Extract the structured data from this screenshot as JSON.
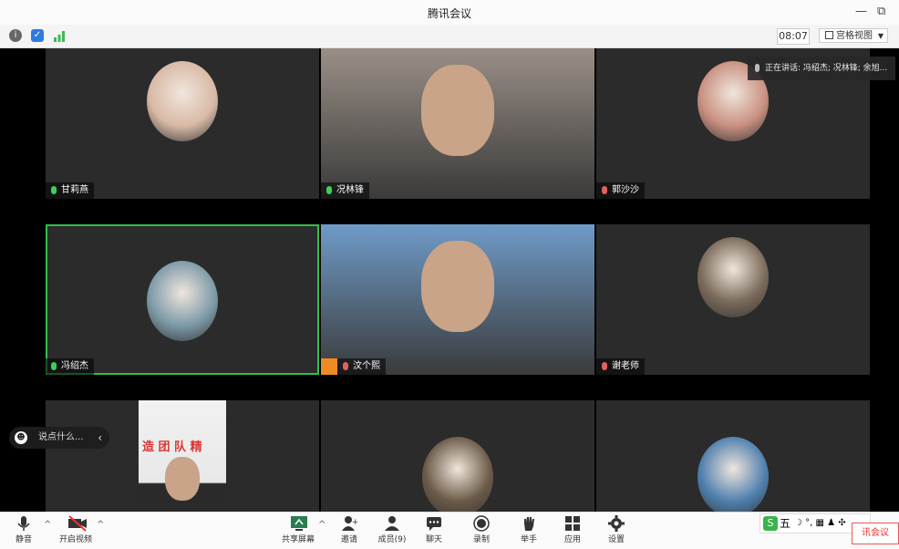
{
  "window": {
    "title": "腾讯会议",
    "minimize_glyph": "—",
    "restore_glyph": "⧉"
  },
  "statusbar": {
    "icons": [
      "info-icon",
      "shield-icon",
      "signal-icon"
    ],
    "timer": "08:07",
    "view_label": "宫格视图"
  },
  "notification": {
    "text": "正在讲话: 冯绍杰; 况林锋; 余旭..."
  },
  "participants": [
    {
      "name": "甘莉燕",
      "mic": "on",
      "type": "avatar",
      "avatar_color": "#d9b9a6"
    },
    {
      "name": "况林锋",
      "mic": "on",
      "type": "video",
      "video_color": "#9a8f86"
    },
    {
      "name": "郭沙沙",
      "mic": "muted",
      "type": "avatar",
      "avatar_color": "#c99080"
    },
    {
      "name": "冯绍杰",
      "mic": "on",
      "type": "avatar",
      "avatar_color": "#7d9aa8",
      "active": true
    },
    {
      "name": "汶个熙",
      "mic": "muted",
      "type": "video",
      "video_color": "#6f9bc8",
      "host_badge": true
    },
    {
      "name": "谢老师",
      "mic": "muted",
      "type": "avatar",
      "avatar_color": "#7a6a5a"
    },
    {
      "name": "",
      "mic": "none",
      "type": "video",
      "video_color": "#d8d8d8",
      "banner_text": "造 团 队 精"
    },
    {
      "name": "",
      "mic": "none",
      "type": "avatar",
      "avatar_color": "#6b5a48"
    },
    {
      "name": "",
      "mic": "none",
      "type": "avatar",
      "avatar_color": "#4f7fae"
    }
  ],
  "chat": {
    "placeholder": "说点什么...",
    "collapse_glyph": "‹"
  },
  "toolbar": {
    "mute_label": "静音",
    "video_label": "开启视频",
    "share_label": "共享屏幕",
    "invite_label": "邀请",
    "members_label": "成员(9)",
    "chat_label": "聊天",
    "record_label": "录制",
    "hand_label": "举手",
    "apps_label": "应用",
    "settings_label": "设置"
  },
  "ime": {
    "mode": "五",
    "symbols": "☽ °, ▦ ♟ ✣"
  },
  "corner": {
    "text": "讯会议"
  },
  "colors": {
    "tile_bg": "#2b2b2b",
    "active_border": "#2fbf4a",
    "mic_on": "#3ccf5a",
    "mic_muted": "#e06060",
    "host_badge": "#f08a24"
  }
}
